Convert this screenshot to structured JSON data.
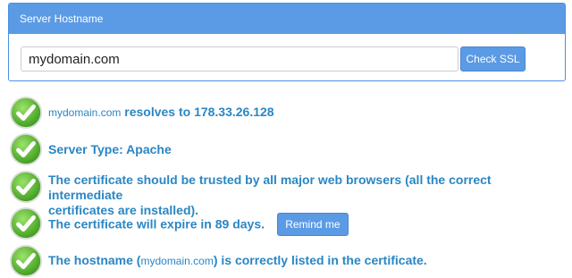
{
  "panel": {
    "header": "Server Hostname",
    "input_value": "mydomain.com",
    "check_button": "Check SSL"
  },
  "colors": {
    "accent": "#5b9be5",
    "result_text": "#2a86c4",
    "check_green": "#4caf2a"
  },
  "results": [
    {
      "icon": "check-icon",
      "prefix": "mydomain.com",
      "text": " resolves to 178.33.26.128"
    },
    {
      "icon": "check-icon",
      "text": "Server Type: Apache"
    },
    {
      "icon": "check-icon",
      "line1": "The certificate should be trusted by all major web browsers (all the correct intermediate",
      "line2": "certificates are installed)."
    },
    {
      "icon": "check-icon",
      "text": "The certificate will expire in 89 days.",
      "button": "Remind me"
    },
    {
      "icon": "check-icon",
      "before": "The hostname (",
      "host": "mydomain.com",
      "after": ") is correctly listed in the certificate."
    }
  ]
}
